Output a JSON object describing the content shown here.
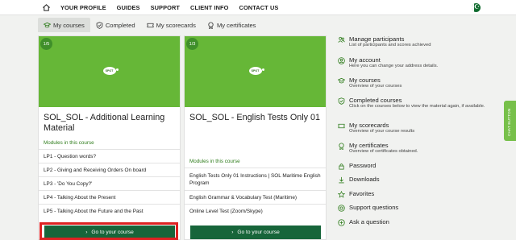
{
  "nav": {
    "links": [
      "YOUR PROFILE",
      "GUIDES",
      "SUPPORT",
      "CLIENT INFO",
      "CONTACT US"
    ]
  },
  "tabs": [
    {
      "label": "My courses",
      "icon": "graduation-cap-icon",
      "active": true
    },
    {
      "label": "Completed",
      "icon": "check-shield-icon",
      "active": false
    },
    {
      "label": "My scorecards",
      "icon": "ticket-icon",
      "active": false
    },
    {
      "label": "My certificates",
      "icon": "certificate-icon",
      "active": false
    }
  ],
  "courses": [
    {
      "badge": "1/5",
      "logo": "SPOT",
      "title": "SOL_SOL - Additional Learning Material",
      "modules_label": "Modules in this course",
      "modules": [
        "LP1 - Question words?",
        "LP2 - Giving and Receiving Orders On board",
        "LP3 - 'Do You Copy?'",
        "LP4 - Talking About the Present",
        "LP5 - Talking About the Future and the Past"
      ],
      "cta": "Go to your course"
    },
    {
      "badge": "1/3",
      "logo": "SPOT",
      "title": "SOL_SOL - English Tests Only 01",
      "modules_label": "Modules in this course",
      "modules": [
        "English Tests Only 01 Instructions | SOL Maritime English Program",
        "English Grammar & Vocabulary Test (Maritime)",
        "Online Level Test (Zoom/Skype)"
      ],
      "cta": "Go to your course"
    }
  ],
  "sidebar": {
    "items": [
      {
        "title": "Manage participants",
        "desc": "List of participants and scores achieved",
        "icon": "users-icon"
      },
      {
        "title": "My account",
        "desc": "Here you can change your address details.",
        "icon": "user-icon"
      },
      {
        "title": "My courses",
        "desc": "Overview of your courses",
        "icon": "graduation-cap-icon"
      },
      {
        "title": "Completed courses",
        "desc": "Click on the courses below to view the material again, if available.",
        "icon": "check-shield-icon"
      },
      {
        "title": "My scorecards",
        "desc": "Overview of your course results",
        "icon": "ticket-icon"
      },
      {
        "title": "My certificates",
        "desc": "Overview of certificates obtained.",
        "icon": "certificate-icon"
      },
      {
        "title": "Password",
        "desc": "",
        "icon": "lock-icon"
      },
      {
        "title": "Downloads",
        "desc": "",
        "icon": "download-icon"
      },
      {
        "title": "Favorites",
        "desc": "",
        "icon": "star-icon"
      },
      {
        "title": "Support questions",
        "desc": "",
        "icon": "help-icon"
      },
      {
        "title": "Ask a question",
        "desc": "",
        "icon": "plus-circle-icon"
      }
    ]
  },
  "chat_button": "CHAT BUTTON",
  "colors": {
    "accent_green": "#2f7d1c",
    "card_header": "#66b737",
    "cta": "#17653a",
    "highlight": "#dd2222"
  }
}
